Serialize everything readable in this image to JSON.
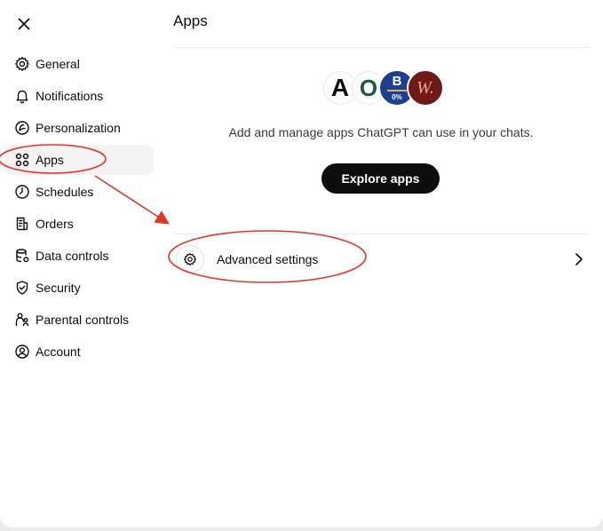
{
  "nav": {
    "items": [
      {
        "label": "General",
        "icon": "gear-icon"
      },
      {
        "label": "Notifications",
        "icon": "bell-icon"
      },
      {
        "label": "Personalization",
        "icon": "personalization-icon"
      },
      {
        "label": "Apps",
        "icon": "apps-grid-icon",
        "active": true
      },
      {
        "label": "Schedules",
        "icon": "clock-icon"
      },
      {
        "label": "Orders",
        "icon": "receipt-icon"
      },
      {
        "label": "Data controls",
        "icon": "database-icon"
      },
      {
        "label": "Security",
        "icon": "shield-icon"
      },
      {
        "label": "Parental controls",
        "icon": "parent-child-icon"
      },
      {
        "label": "Account",
        "icon": "user-circle-icon"
      }
    ]
  },
  "main": {
    "title": "Apps",
    "description": "Add and manage apps ChatGPT can use in your chats.",
    "explore_label": "Explore apps",
    "advanced_label": "Advanced settings",
    "logos": [
      {
        "name": "logo-a",
        "glyph": "A",
        "bg": "#ffffff",
        "fg": "#0d0d0d"
      },
      {
        "name": "logo-o",
        "glyph": "O",
        "bg": "#ffffff",
        "fg": "#1f5a3d"
      },
      {
        "name": "logo-b",
        "glyph": "B",
        "sub": "0%",
        "bg": "#1e3f8c",
        "fg": "#ffffff"
      },
      {
        "name": "logo-w",
        "glyph": "W.",
        "bg": "#6e1a17",
        "fg": "#f0a090"
      }
    ]
  },
  "colors": {
    "annotation": "#e0392b",
    "active_bg": "#f3f3f3",
    "button_bg": "#0d0d0d"
  }
}
